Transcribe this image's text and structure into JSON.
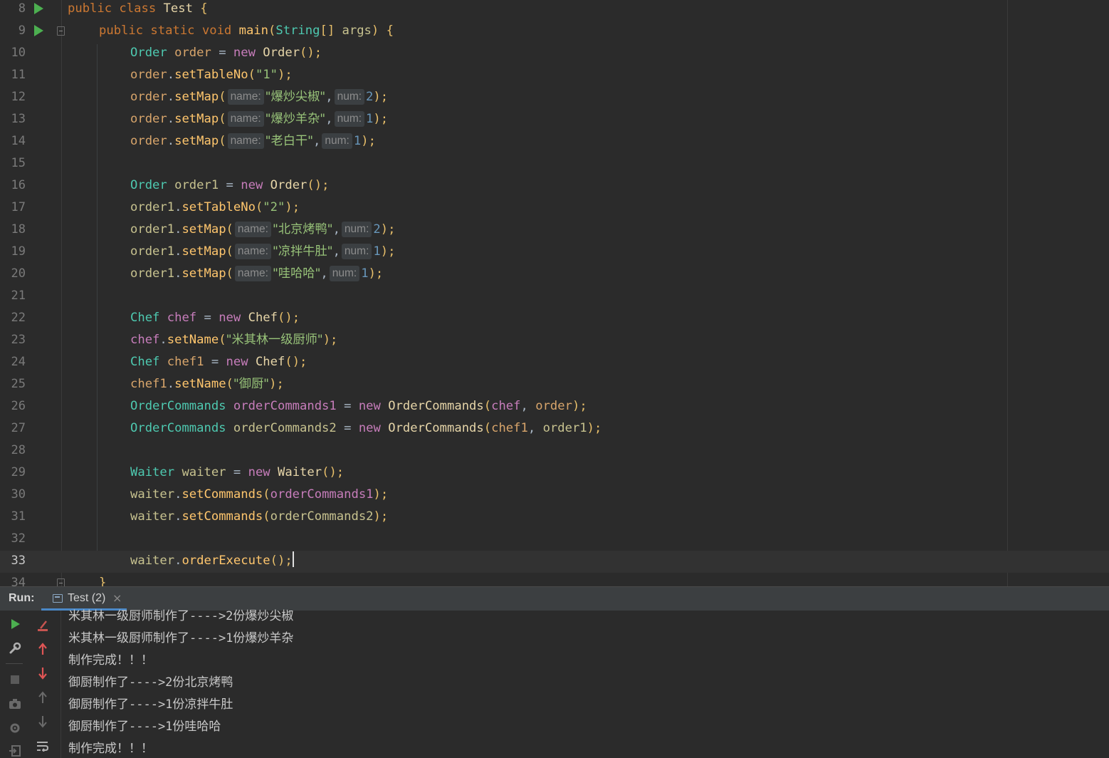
{
  "editor": {
    "lines": [
      {
        "n": "8"
      },
      {
        "n": "9"
      },
      {
        "n": "10"
      },
      {
        "n": "11"
      },
      {
        "n": "12"
      },
      {
        "n": "13"
      },
      {
        "n": "14"
      },
      {
        "n": "15"
      },
      {
        "n": "16"
      },
      {
        "n": "17"
      },
      {
        "n": "18"
      },
      {
        "n": "19"
      },
      {
        "n": "20"
      },
      {
        "n": "21"
      },
      {
        "n": "22"
      },
      {
        "n": "23"
      },
      {
        "n": "24"
      },
      {
        "n": "25"
      },
      {
        "n": "26"
      },
      {
        "n": "27"
      },
      {
        "n": "28"
      },
      {
        "n": "29"
      },
      {
        "n": "30"
      },
      {
        "n": "31"
      },
      {
        "n": "32"
      },
      {
        "n": "33"
      },
      {
        "n": "34"
      }
    ],
    "code": {
      "l8": {
        "a": "public class ",
        "b": "Test",
        "c": " {"
      },
      "l9": {
        "a": "public static void ",
        "b": "main",
        "c": "(",
        "d": "String",
        "e": "[] ",
        "f": "args",
        "g": ") {"
      },
      "l10": {
        "a": "Order",
        "b": " order ",
        "c": "= ",
        "d": "new ",
        "e": "Order",
        "f": "();"
      },
      "l11": {
        "a": "order",
        "b": ".",
        "c": "setTableNo",
        "d": "(",
        "e": "\"1\"",
        "f": ");"
      },
      "l12": {
        "a": "order",
        "b": ".",
        "c": "setMap",
        "d": "(",
        "hn": "name:",
        "e": "\"爆炒尖椒\"",
        "f": ",",
        "hm": "num:",
        "g": "2",
        "h": ");"
      },
      "l13": {
        "a": "order",
        "b": ".",
        "c": "setMap",
        "d": "(",
        "hn": "name:",
        "e": "\"爆炒羊杂\"",
        "f": ",",
        "hm": "num:",
        "g": "1",
        "h": ");"
      },
      "l14": {
        "a": "order",
        "b": ".",
        "c": "setMap",
        "d": "(",
        "hn": "name:",
        "e": "\"老白干\"",
        "f": ",",
        "hm": "num:",
        "g": "1",
        "h": ");"
      },
      "l16": {
        "a": "Order",
        "b": " order1 ",
        "c": "= ",
        "d": "new ",
        "e": "Order",
        "f": "();"
      },
      "l17": {
        "a": "order1",
        "b": ".",
        "c": "setTableNo",
        "d": "(",
        "e": "\"2\"",
        "f": ");"
      },
      "l18": {
        "a": "order1",
        "b": ".",
        "c": "setMap",
        "d": "(",
        "hn": "name:",
        "e": "\"北京烤鸭\"",
        "f": ",",
        "hm": "num:",
        "g": "2",
        "h": ");"
      },
      "l19": {
        "a": "order1",
        "b": ".",
        "c": "setMap",
        "d": "(",
        "hn": "name:",
        "e": "\"凉拌牛肚\"",
        "f": ",",
        "hm": "num:",
        "g": "1",
        "h": ");"
      },
      "l20": {
        "a": "order1",
        "b": ".",
        "c": "setMap",
        "d": "(",
        "hn": "name:",
        "e": "\"哇哈哈\"",
        "f": ",",
        "hm": "num:",
        "g": "1",
        "h": ");"
      },
      "l22": {
        "a": "Chef",
        "b": " chef ",
        "c": "= ",
        "d": "new ",
        "e": "Chef",
        "f": "();"
      },
      "l23": {
        "a": "chef",
        "b": ".",
        "c": "setName",
        "d": "(",
        "e": "\"米其林一级厨师\"",
        "f": ");"
      },
      "l24": {
        "a": "Chef",
        "b": " chef1 ",
        "c": "= ",
        "d": "new ",
        "e": "Chef",
        "f": "();"
      },
      "l25": {
        "a": "chef1",
        "b": ".",
        "c": "setName",
        "d": "(",
        "e": "\"御厨\"",
        "f": ");"
      },
      "l26": {
        "a": "OrderCommands",
        "b": " orderCommands1 ",
        "c": "= ",
        "d": "new ",
        "e": "OrderCommands",
        "f": "(",
        "g": "chef",
        "h": ", ",
        "i": "order",
        "j": ");"
      },
      "l27": {
        "a": "OrderCommands",
        "b": " orderCommands2 ",
        "c": "= ",
        "d": "new ",
        "e": "OrderCommands",
        "f": "(",
        "g": "chef1",
        "h": ", ",
        "i": "order1",
        "j": ");"
      },
      "l29": {
        "a": "Waiter",
        "b": " waiter ",
        "c": "= ",
        "d": "new ",
        "e": "Waiter",
        "f": "();"
      },
      "l30": {
        "a": "waiter",
        "b": ".",
        "c": "setCommands",
        "d": "(",
        "e": "orderCommands1",
        "f": ");"
      },
      "l31": {
        "a": "waiter",
        "b": ".",
        "c": "setCommands",
        "d": "(",
        "e": "orderCommands2",
        "f": ");"
      },
      "l33": {
        "a": "waiter",
        "b": ".",
        "c": "orderExecute",
        "d": "();"
      },
      "l34": {
        "a": "}"
      }
    }
  },
  "run_panel": {
    "label": "Run:",
    "tab_label": "Test (2)",
    "tab_close": "×",
    "toolbar_icons": [
      "rerun-icon",
      "wrench-icon",
      "stop-icon",
      "camera-icon",
      "settings-icon",
      "exit-icon",
      "clear-icon",
      "arrow-up-icon",
      "arrow-down-icon",
      "scroll-up-icon",
      "scroll-down-icon",
      "soft-wrap-icon"
    ],
    "output": [
      {
        "a": "米其林一级厨师制作了",
        "b": "---->2",
        "c": "份爆炒尖椒"
      },
      {
        "a": "米其林一级厨师制作了",
        "b": "---->1",
        "c": "份爆炒羊杂"
      },
      {
        "a": "制作完成！！！",
        "b": "",
        "c": ""
      },
      {
        "a": "御厨制作了",
        "b": "---->2",
        "c": "份北京烤鸭"
      },
      {
        "a": "御厨制作了",
        "b": "---->1",
        "c": "份凉拌牛肚"
      },
      {
        "a": "御厨制作了",
        "b": "---->1",
        "c": "份哇哈哈"
      },
      {
        "a": "制作完成！！！",
        "b": "",
        "c": ""
      }
    ]
  },
  "colors": {
    "editor_bg": "#2b2b2b",
    "run_icon": "#4caf50",
    "tab_underline": "#4a88c7"
  }
}
